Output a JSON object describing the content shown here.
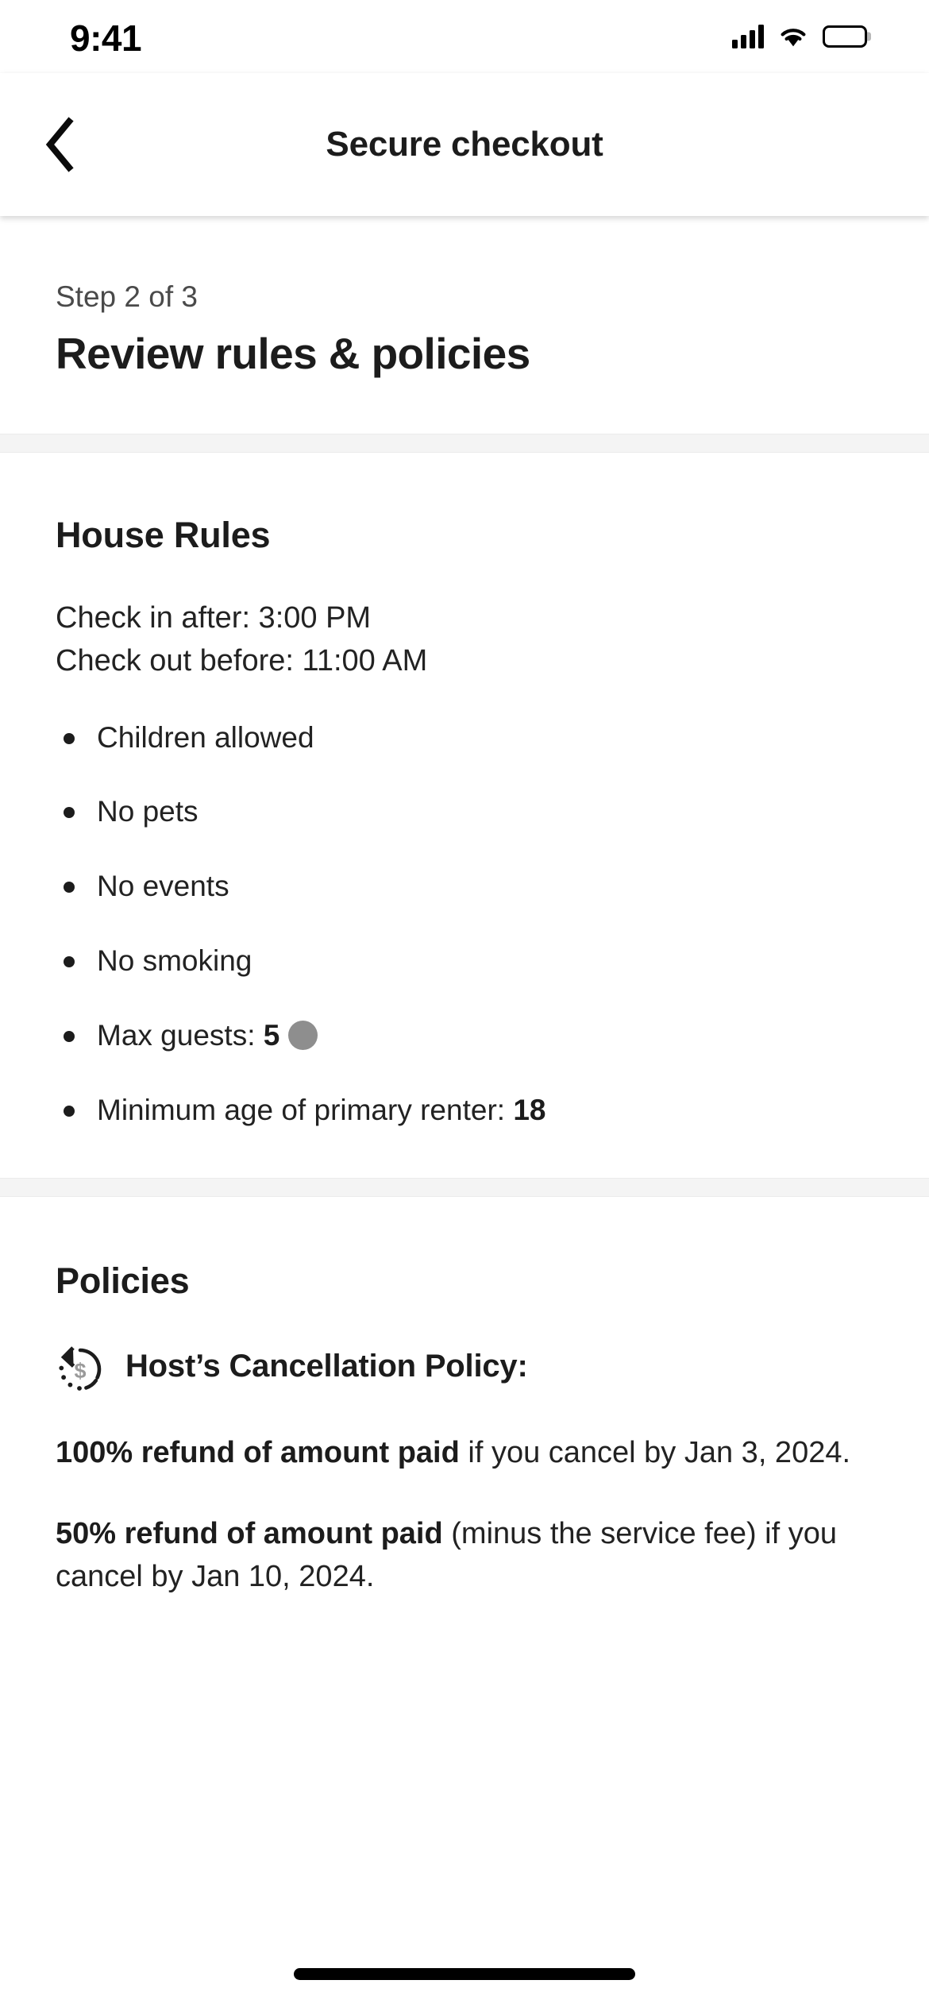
{
  "status_bar": {
    "time": "9:41",
    "signal_icon": "cellular-signal-icon",
    "wifi_icon": "wifi-icon",
    "battery_icon": "battery-icon"
  },
  "nav": {
    "back_icon": "chevron-left-icon",
    "title": "Secure checkout"
  },
  "step": {
    "label": "Step 2 of 3",
    "title": "Review rules & policies"
  },
  "house_rules": {
    "heading": "House Rules",
    "check_in": "Check in after: 3:00 PM",
    "check_out": "Check out before: 11:00 AM",
    "rules": [
      {
        "text": "Children allowed",
        "value": ""
      },
      {
        "text": "No pets",
        "value": ""
      },
      {
        "text": "No events",
        "value": ""
      },
      {
        "text": "No smoking",
        "value": ""
      },
      {
        "text": "Max guests: ",
        "value": "5"
      },
      {
        "text": "Minimum age of primary renter: ",
        "value": "18"
      }
    ]
  },
  "policies": {
    "heading": "Policies",
    "cancellation_icon": "refund-dollar-icon",
    "cancellation_title": "Host’s Cancellation Policy:",
    "paragraphs": [
      {
        "bold": "100% refund of amount paid",
        "rest": " if you cancel by Jan 3, 2024."
      },
      {
        "bold": "50% refund of amount paid",
        "rest": " (minus the service fee) if you cancel by Jan 10, 2024."
      }
    ]
  },
  "home_indicator": "home-indicator"
}
